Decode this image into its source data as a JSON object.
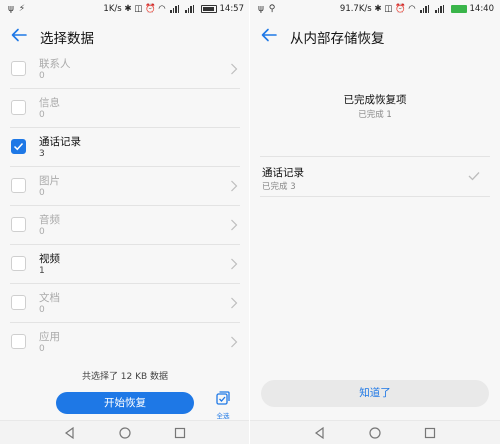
{
  "left": {
    "status": {
      "speed": "1K/s",
      "clock": "14:57"
    },
    "title": "选择数据",
    "items": [
      {
        "label": "联系人",
        "count": "0",
        "checked": false,
        "enabled": false
      },
      {
        "label": "信息",
        "count": "0",
        "checked": false,
        "enabled": false
      },
      {
        "label": "通话记录",
        "count": "3",
        "checked": true,
        "enabled": true
      },
      {
        "label": "图片",
        "count": "0",
        "checked": false,
        "enabled": false
      },
      {
        "label": "音频",
        "count": "0",
        "checked": false,
        "enabled": false
      },
      {
        "label": "视频",
        "count": "1",
        "checked": false,
        "enabled": true
      },
      {
        "label": "文档",
        "count": "0",
        "checked": false,
        "enabled": false
      },
      {
        "label": "应用",
        "count": "0",
        "checked": false,
        "enabled": false
      }
    ],
    "summary": "共选择了 12 KB 数据",
    "start_button": "开始恢复",
    "select_all": "全选"
  },
  "right": {
    "status": {
      "speed": "91.7K/s",
      "clock": "14:40"
    },
    "title": "从内部存储恢复",
    "done_heading": "已完成恢复项",
    "done_sub": "已完成 1",
    "result": {
      "name": "通话记录",
      "status": "已完成 3"
    },
    "ok_button": "知道了"
  },
  "colors": {
    "accent": "#1e78e6",
    "battery_charging": "#3ab54a"
  }
}
